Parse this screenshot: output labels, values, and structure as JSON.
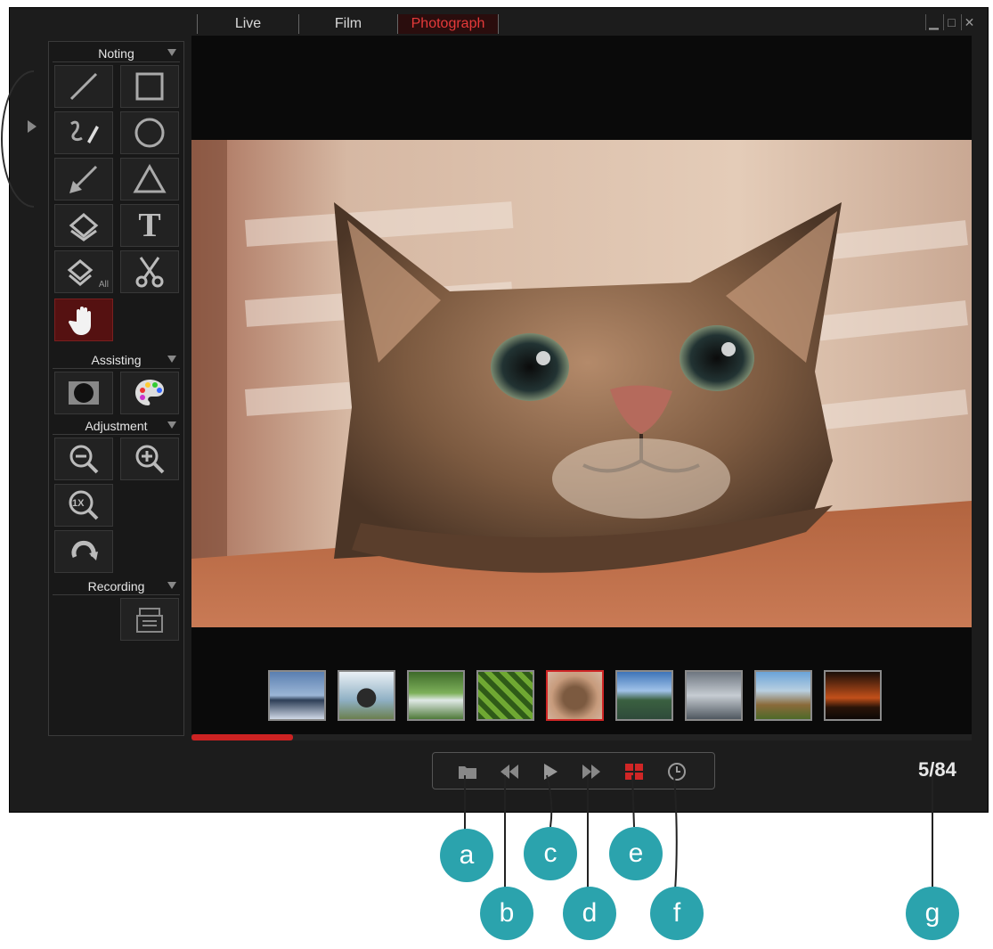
{
  "tabs": [
    {
      "label": "Live"
    },
    {
      "label": "Film"
    },
    {
      "label": "Photograph",
      "active": true
    }
  ],
  "window_controls": [
    "minimize-icon",
    "restore-icon",
    "close-icon"
  ],
  "toolbox": {
    "sections": {
      "noting": "Noting",
      "assisting": "Assisting",
      "adjustment": "Adjustment",
      "recording": "Recording"
    },
    "tools": {
      "noting": [
        "line-icon",
        "rectangle-icon",
        "freehand-pen-icon",
        "circle-icon",
        "arrow-icon",
        "triangle-icon",
        "eraser-icon",
        "text-icon",
        "eraser-all-icon",
        "scissors-icon",
        "hand-icon"
      ],
      "eraser_all_sub": "All",
      "text_glyph": "T",
      "assisting": [
        "spotlight-icon",
        "palette-icon"
      ],
      "adjustment": [
        "zoom-out-icon",
        "zoom-in-icon",
        "zoom-1x-icon",
        "rotate-icon"
      ],
      "zoom_1x_glyph": "1X",
      "recording": [
        "record-icon"
      ]
    },
    "active_tool": "hand-icon"
  },
  "thumbnails": {
    "count": 9,
    "selected_index": 4
  },
  "playback_progress": 0.13,
  "controls": [
    "folder-icon",
    "rewind-icon",
    "play-icon",
    "fast-forward-icon",
    "grid-icon",
    "timer-icon"
  ],
  "counter": "5/84",
  "callouts": [
    "a",
    "b",
    "c",
    "d",
    "e",
    "f",
    "g"
  ],
  "colors": {
    "accent": "#d02626",
    "callout": "#2ba3ad"
  }
}
